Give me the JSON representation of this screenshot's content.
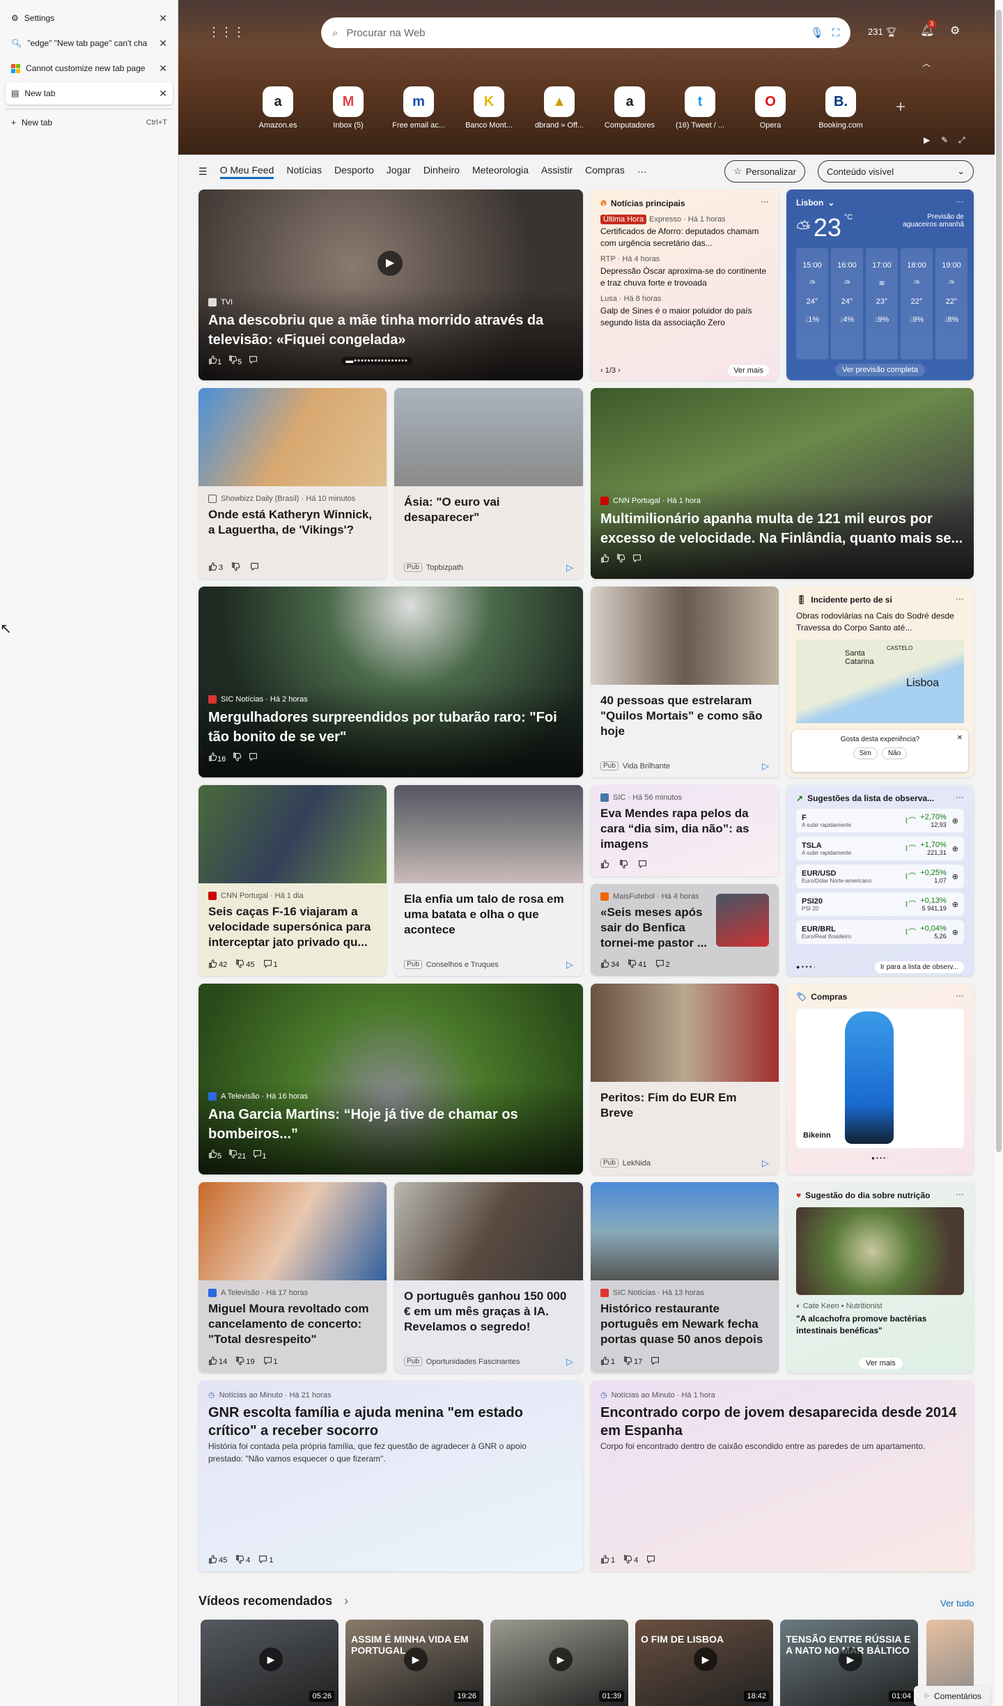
{
  "tabs": [
    {
      "label": "Settings",
      "icon": "gear-icon"
    },
    {
      "label": "\"edge\" \"New tab page\" can't cha",
      "icon": "search-icon"
    },
    {
      "label": "Cannot customize new tab page",
      "icon": "microsoft-icon"
    },
    {
      "label": "New tab",
      "icon": "page-icon",
      "active": true
    }
  ],
  "new_tab": {
    "label": "New tab",
    "shortcut": "Ctrl+T"
  },
  "header": {
    "search_placeholder": "Procurar na Web",
    "points": "231",
    "notifications": "3"
  },
  "quick_links": [
    {
      "label": "Amazon.es",
      "glyph": "a"
    },
    {
      "label": "Inbox (5)",
      "glyph": "M"
    },
    {
      "label": "Free email ac...",
      "glyph": "m"
    },
    {
      "label": "Banco Mont...",
      "glyph": "K"
    },
    {
      "label": "dbrand » Off...",
      "glyph": "▲"
    },
    {
      "label": "Computadores",
      "glyph": "a"
    },
    {
      "label": "(16) Tweet / ...",
      "glyph": "t"
    },
    {
      "label": "Opera",
      "glyph": "O"
    },
    {
      "label": "Booking.com",
      "glyph": "B."
    }
  ],
  "nav": {
    "items": [
      "O Meu Feed",
      "Notícias",
      "Desporto",
      "Jogar",
      "Dinheiro",
      "Meteorologia",
      "Assistir",
      "Compras"
    ],
    "more": "···",
    "personalize": "Personalizar",
    "content_select": "Conteúdo visível"
  },
  "hero": {
    "source": "TVI",
    "title": "Ana descobriu que a mãe tinha morrido através da televisão: «Fiquei congelada»",
    "likes": "1",
    "dislikes": "5"
  },
  "top_news": {
    "title": "Notícias principais",
    "badge": "Última Hora",
    "items": [
      {
        "source": "Expresso · Há 1 horas",
        "title": "Certificados de Aforro: deputados chamam com urgência secretário das..."
      },
      {
        "source": "RTP · Há 4 horas",
        "title": "Depressão Óscar aproxima-se do continente e traz chuva forte e trovoada"
      },
      {
        "source": "Lusa · Há 8 horas",
        "title": "Galp de Sines é o maior poluidor do país segundo lista da associação Zero"
      }
    ],
    "pager": "1/3",
    "more": "Ver mais"
  },
  "weather": {
    "city": "Lisbon",
    "temp": "23",
    "unit": "°C",
    "forecast_note": "Previsão de aguaceiros amanhã",
    "hours": [
      {
        "time": "15:00",
        "temp": "24°",
        "rain": "1%"
      },
      {
        "time": "16:00",
        "temp": "24°",
        "rain": "4%"
      },
      {
        "time": "17:00",
        "temp": "23°",
        "rain": "9%"
      },
      {
        "time": "18:00",
        "temp": "22°",
        "rain": "9%"
      },
      {
        "time": "19:00",
        "temp": "22°",
        "rain": "8%"
      }
    ],
    "full": "Ver previsão completa"
  },
  "cards": {
    "katheryn": {
      "source": "Showbizz Daily (Brasil) · Há 10 minutos",
      "title": "Onde está Katheryn Winnick, a Laguertha, de 'Vikings'?",
      "likes": "3"
    },
    "asia": {
      "title": "Ásia: \"O euro vai desaparecer\"",
      "pub": "Pub",
      "sponsor": "Topbizpath"
    },
    "multi": {
      "source": "CNN Portugal · Há 1 hora",
      "title": "Multimilionário apanha multa de 121 mil euros por excesso de velocidade. Na Finlândia, quanto mais se..."
    },
    "shark": {
      "source": "SIC Notícias · Há 2 horas",
      "title": "Mergulhadores surpreendidos por tubarão raro: \"Foi tão bonito de se ver\"",
      "likes": "16"
    },
    "quilos": {
      "title": "40 pessoas que estrelaram \"Quilos Mortais\" e como são hoje",
      "pub": "Pub",
      "sponsor": "Vida Brilhante"
    },
    "f16": {
      "source": "CNN Portugal · Há 1 dia",
      "title": "Seis caças F-16 viajaram a velocidade supersónica para interceptar jato privado qu...",
      "likes": "42",
      "dislikes": "45",
      "comments": "1"
    },
    "rosa": {
      "title": "Ela enfia um talo de rosa em uma batata e olha o que acontece",
      "pub": "Pub",
      "sponsor": "Conselhos e Truques"
    },
    "eva": {
      "source": "SIC · Há 56 minutos",
      "title": "Eva Mendes rapa pelos da cara “dia sim, dia não”: as imagens"
    },
    "benfica": {
      "source": "MaisFutebol · Há 4 horas",
      "title": "«Seis meses após sair do Benfica tornei-me pastor ...",
      "likes": "34",
      "dislikes": "41",
      "comments": "2"
    },
    "ana": {
      "source": "A Televisão · Há 16 horas",
      "title": "Ana Garcia Martins: “Hoje já tive de chamar os bombeiros...”",
      "likes": "5",
      "dislikes": "21",
      "comments": "1"
    },
    "peritos": {
      "title": "Peritos: Fim do EUR Em Breve",
      "pub": "Pub",
      "sponsor": "LekNida"
    },
    "miguel": {
      "source": "A Televisão · Há 17 horas",
      "title": "Miguel Moura revoltado com cancelamento de concerto: \"Total desrespeito\"",
      "likes": "14",
      "dislikes": "19",
      "comments": "1"
    },
    "ia": {
      "title": "O português ganhou 150 000 € em um mês graças à IA. Revelamos o segredo!",
      "pub": "Pub",
      "sponsor": "Oportunidades Fascinantes"
    },
    "newark": {
      "source": "SIC Notícias · Há 13 horas",
      "title": "Histórico restaurante português em Newark fecha portas quase 50 anos depois",
      "likes": "1",
      "dislikes": "17"
    },
    "gnr": {
      "source": "Notícias ao Minuto · Há 21 horas",
      "title": "GNR escolta família e ajuda menina \"em estado crítico\" a receber socorro",
      "desc": "História foi contada pela própria família, que fez questão de agradecer à GNR o apoio prestado: \"Não vamos esquecer o que fizeram\".",
      "likes": "45",
      "dislikes": "4",
      "comments": "1"
    },
    "espanha": {
      "source": "Notícias ao Minuto · Há 1 hora",
      "title": "Encontrado corpo de jovem desaparecida desde 2014 em Espanha",
      "desc": "Corpo foi encontrado dentro de caixão escondido entre as paredes de um apartamento.",
      "likes": "1",
      "dislikes": "4"
    }
  },
  "traffic": {
    "title": "Incidente perto de si",
    "text": "Obras rodoviárias na Cais do Sodré desde Travessa do Corpo Santo até...",
    "map_labels": [
      "Santa Catarina",
      "CASTELO",
      "Lisboa"
    ],
    "feedback": "Gosta desta experiência?",
    "yes": "Sim",
    "no": "Não"
  },
  "watchlist": {
    "title": "Sugestões da lista de observa...",
    "stocks": [
      {
        "sym": "F",
        "sub": "A subir rapidamente",
        "chg": "+2,70%",
        "price": "12,93"
      },
      {
        "sym": "TSLA",
        "sub": "A subir rapidamente",
        "chg": "+1,70%",
        "price": "221,31"
      },
      {
        "sym": "EUR/USD",
        "sub": "Euro/Dólar Norte-americano",
        "chg": "+0,25%",
        "price": "1,07"
      },
      {
        "sym": "PSI20",
        "sub": "PSI 20",
        "chg": "+0,13%",
        "price": "5 941,19"
      },
      {
        "sym": "EUR/BRL",
        "sub": "Euro/Real Brasileiro",
        "chg": "+0,04%",
        "price": "5,26"
      }
    ],
    "link": "Ir para a lista de observ..."
  },
  "shopping": {
    "title": "Compras",
    "store": "Bikeinn"
  },
  "nutrition": {
    "title": "Sugestão do dia sobre nutrição",
    "author": "Cate Keen",
    "role": "Nutritionist",
    "quote": "\"A alcachofra promove bactérias intestinais benéficas\"",
    "more": "Ver mais"
  },
  "videos": {
    "title": "Vídeos recomendados",
    "all": "Ver tudo",
    "items": [
      {
        "duration": "05:26"
      },
      {
        "duration": "19:26",
        "overlay": "ASSIM É MINHA VIDA EM PORTUGAL"
      },
      {
        "duration": "01:39"
      },
      {
        "duration": "18:42",
        "overlay": "O FIM DE LISBOA"
      },
      {
        "duration": "01:04",
        "overlay": "TENSÃO ENTRE RÚSSIA E A NATO NO MAR BÁLTICO"
      }
    ]
  },
  "comments_button": "Comentários",
  "colors": {
    "accent": "#0f6cbd",
    "weather_bg": "#3b64ae",
    "breaking": "#c42b1c"
  }
}
